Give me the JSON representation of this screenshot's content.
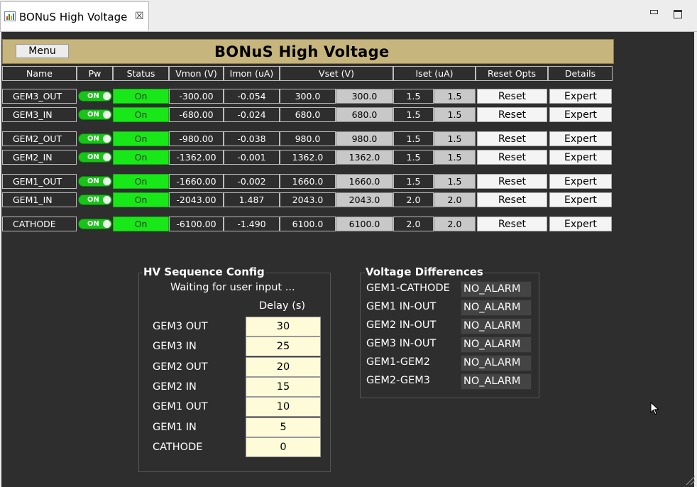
{
  "tab": {
    "title": "BONuS High Voltage",
    "close_glyph": "☒"
  },
  "header": {
    "menu_label": "Menu",
    "title": "BONuS High Voltage"
  },
  "columns": {
    "name": "Name",
    "pw": "Pw",
    "status": "Status",
    "vmon": "Vmon (V)",
    "imon": "Imon (uA)",
    "vset": "Vset (V)",
    "iset": "Iset (uA)",
    "reset_opts": "Reset Opts",
    "details": "Details"
  },
  "rows": [
    {
      "name": "GEM3_OUT",
      "pw": "ON",
      "status": "On",
      "vmon": "-300.00",
      "imon": "-0.054",
      "vset": "300.0",
      "vset_rb": "300.0",
      "iset": "1.5",
      "iset_rb": "1.5",
      "reset": "Reset",
      "expert": "Expert"
    },
    {
      "name": "GEM3_IN",
      "pw": "ON",
      "status": "On",
      "vmon": "-680.00",
      "imon": "-0.024",
      "vset": "680.0",
      "vset_rb": "680.0",
      "iset": "1.5",
      "iset_rb": "1.5",
      "reset": "Reset",
      "expert": "Expert"
    },
    {
      "name": "GEM2_OUT",
      "pw": "ON",
      "status": "On",
      "vmon": "-980.00",
      "imon": "-0.038",
      "vset": "980.0",
      "vset_rb": "980.0",
      "iset": "1.5",
      "iset_rb": "1.5",
      "reset": "Reset",
      "expert": "Expert"
    },
    {
      "name": "GEM2_IN",
      "pw": "ON",
      "status": "On",
      "vmon": "-1362.00",
      "imon": "-0.001",
      "vset": "1362.0",
      "vset_rb": "1362.0",
      "iset": "1.5",
      "iset_rb": "1.5",
      "reset": "Reset",
      "expert": "Expert"
    },
    {
      "name": "GEM1_OUT",
      "pw": "ON",
      "status": "On",
      "vmon": "-1660.00",
      "imon": "-0.002",
      "vset": "1660.0",
      "vset_rb": "1660.0",
      "iset": "1.5",
      "iset_rb": "1.5",
      "reset": "Reset",
      "expert": "Expert"
    },
    {
      "name": "GEM1_IN",
      "pw": "ON",
      "status": "On",
      "vmon": "-2043.00",
      "imon": "1.487",
      "vset": "2043.0",
      "vset_rb": "2043.0",
      "iset": "2.0",
      "iset_rb": "2.0",
      "reset": "Reset",
      "expert": "Expert"
    },
    {
      "name": "CATHODE",
      "pw": "ON",
      "status": "On",
      "vmon": "-6100.00",
      "imon": "-1.490",
      "vset": "6100.0",
      "vset_rb": "6100.0",
      "iset": "2.0",
      "iset_rb": "2.0",
      "reset": "Reset",
      "expert": "Expert"
    }
  ],
  "sequence": {
    "title": "HV Sequence Config",
    "status": "Waiting for user input ...",
    "delay_header": "Delay (s)",
    "items": [
      {
        "label": "GEM3 OUT",
        "delay": "30"
      },
      {
        "label": "GEM3 IN",
        "delay": "25"
      },
      {
        "label": "GEM2 OUT",
        "delay": "20"
      },
      {
        "label": "GEM2 IN",
        "delay": "15"
      },
      {
        "label": "GEM1 OUT",
        "delay": "10"
      },
      {
        "label": "GEM1 IN",
        "delay": "5"
      },
      {
        "label": "CATHODE",
        "delay": "0"
      }
    ]
  },
  "differences": {
    "title": "Voltage Differences",
    "items": [
      {
        "label": "GEM1-CATHODE",
        "value": "NO_ALARM"
      },
      {
        "label": "GEM1 IN-OUT",
        "value": "NO_ALARM"
      },
      {
        "label": "GEM2 IN-OUT",
        "value": "NO_ALARM"
      },
      {
        "label": "GEM3 IN-OUT",
        "value": "NO_ALARM"
      },
      {
        "label": "GEM1-GEM2",
        "value": "NO_ALARM"
      },
      {
        "label": "GEM2-GEM3",
        "value": "NO_ALARM"
      }
    ]
  },
  "colors": {
    "panel": "#2e2e2e",
    "title_bar": "#c6b57c",
    "status_on": "#18e818",
    "toggle_on": "#18c418",
    "delay_field": "#fdfbd8"
  },
  "icons": {
    "tab": "chart-icon",
    "minimize": "minimize-icon",
    "maximize": "maximize-icon",
    "cursor": "mouse-pointer-icon",
    "resize": "resize-grip-icon"
  }
}
